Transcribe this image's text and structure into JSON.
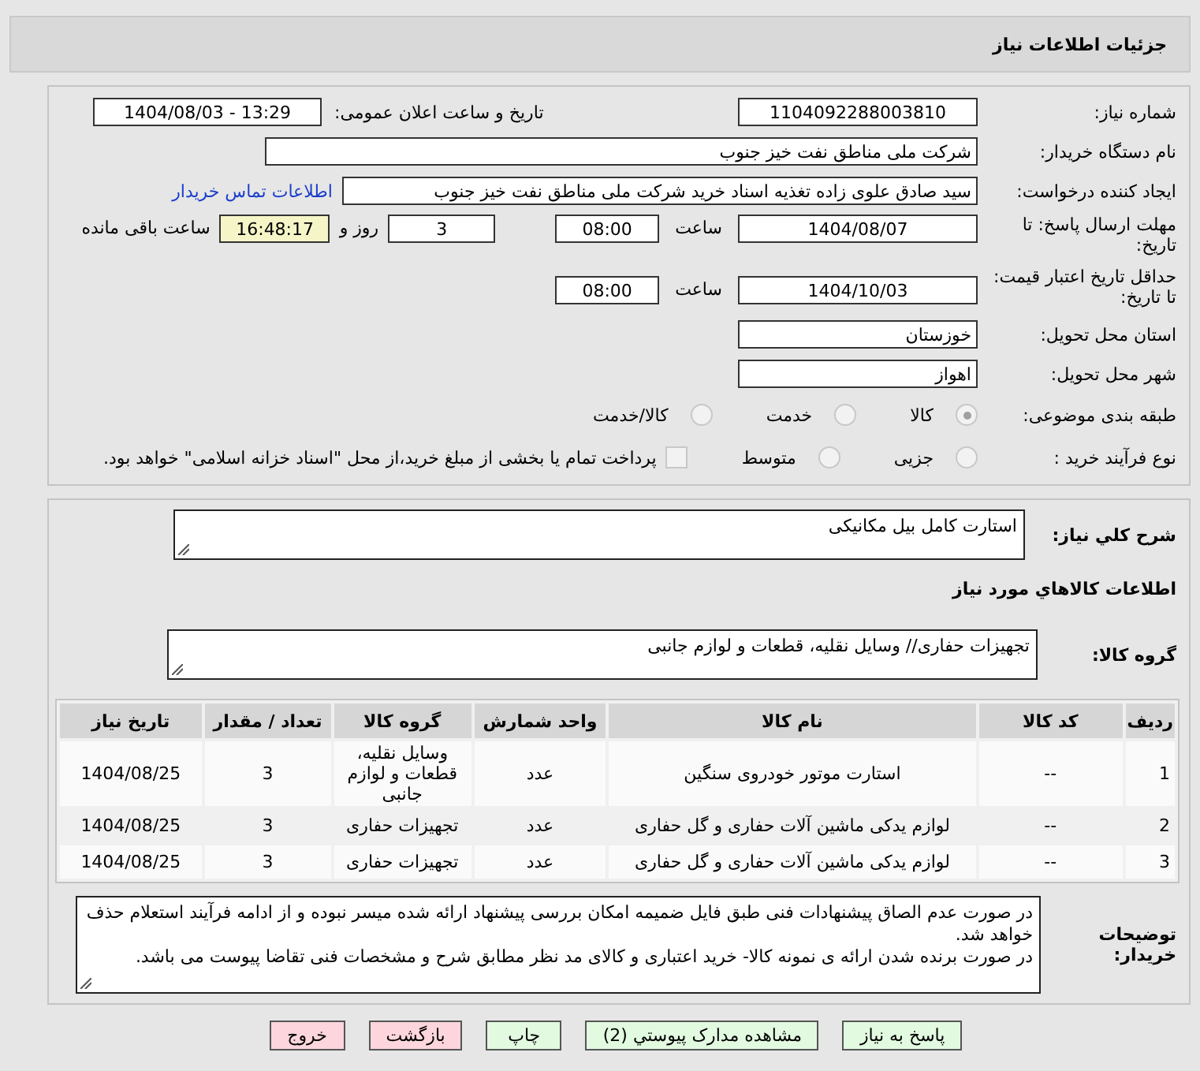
{
  "header": {
    "title": "جزئیات اطلاعات نیاز"
  },
  "form": {
    "need_number": {
      "label": "شماره نیاز:",
      "value": "1104092288003810"
    },
    "announce": {
      "label": "تاریخ و ساعت اعلان عمومی:",
      "value": "1404/08/03 - 13:29"
    },
    "buyer": {
      "label": "نام دستگاه خریدار:",
      "value": "شرکت ملی مناطق نفت خیز جنوب"
    },
    "creator": {
      "label": "ایجاد کننده درخواست:",
      "value": "سید صادق علوی زاده  تغذیه اسناد خرید  شرکت ملی مناطق نفت خیز جنوب",
      "link": "اطلاعات تماس خریدار"
    },
    "deadline": {
      "label": "مهلت ارسال پاسخ: تا تاریخ:",
      "date": "1404/08/07",
      "time_label": "ساعت",
      "time": "08:00",
      "days": "3",
      "days_label": "روز و",
      "remaining": "16:48:17",
      "remaining_label": "ساعت باقی مانده"
    },
    "validity": {
      "label": "حداقل تاریخ اعتبار قیمت: تا تاریخ:",
      "date": "1404/10/03",
      "time_label": "ساعت",
      "time": "08:00"
    },
    "province": {
      "label": "استان محل تحویل:",
      "value": "خوزستان"
    },
    "city": {
      "label": "شهر محل تحویل:",
      "value": "اهواز"
    },
    "category": {
      "label": "طبقه بندی موضوعی:",
      "options": [
        {
          "label": "کالا",
          "selected": true
        },
        {
          "label": "خدمت",
          "selected": false
        },
        {
          "label": "کالا/خدمت",
          "selected": false
        }
      ]
    },
    "process": {
      "label": "نوع فرآیند خرید :",
      "options": [
        {
          "label": "جزیی",
          "selected": false
        },
        {
          "label": "متوسط",
          "selected": false
        }
      ],
      "treasury": {
        "label": "پرداخت تمام یا بخشی از مبلغ خرید،از محل \"اسناد خزانه اسلامی\" خواهد بود.",
        "checked": false
      }
    }
  },
  "details": {
    "summary": {
      "label": "شرح کلي نیاز:",
      "value": "استارت کامل بیل مکانیکی"
    },
    "goods_title": "اطلاعات کالاهاي مورد نیاز",
    "group": {
      "label": "گروه کالا:",
      "value": "تجهیزات حفاری// وسایل نقلیه، قطعات و لوازم جانبی"
    },
    "table": {
      "columns": [
        "ردیف",
        "کد کالا",
        "نام کالا",
        "واحد شمارش",
        "گروه کالا",
        "تعداد / مقدار",
        "تاریخ نیاز"
      ],
      "rows": [
        [
          "1",
          "--",
          "استارت موتور خودروی سنگین",
          "عدد",
          "وسایل نقلیه، قطعات و لوازم جانبی",
          "3",
          "1404/08/25"
        ],
        [
          "2",
          "--",
          "لوازم یدکی ماشین آلات حفاری و گل حفاری",
          "عدد",
          "تجهیزات حفاری",
          "3",
          "1404/08/25"
        ],
        [
          "3",
          "--",
          "لوازم یدکی ماشین آلات حفاری و گل حفاری",
          "عدد",
          "تجهیزات حفاری",
          "3",
          "1404/08/25"
        ]
      ]
    },
    "notes": {
      "label": "توضیحات خریدار:",
      "lines": [
        "در صورت عدم الصاق پیشنهادات فنی طبق فایل ضمیمه امکان بررسی پیشنهاد ارائه شده میسر نبوده و از ادامه فرآیند استعلام حذف خواهد شد.",
        "در صورت برنده شدن ارائه ی نمونه کالا- خرید اعتباری و کالای مد نظر مطابق شرح و مشخصات فنی تقاضا پیوست می باشد."
      ]
    }
  },
  "buttons": [
    {
      "label": "پاسخ به نیاز",
      "kind": "primary"
    },
    {
      "label": "مشاهده مدارک پیوستي (2)",
      "kind": "primary"
    },
    {
      "label": "چاپ",
      "kind": "primary"
    },
    {
      "label": "بازگشت",
      "kind": "danger"
    },
    {
      "label": "خروج",
      "kind": "danger"
    }
  ]
}
